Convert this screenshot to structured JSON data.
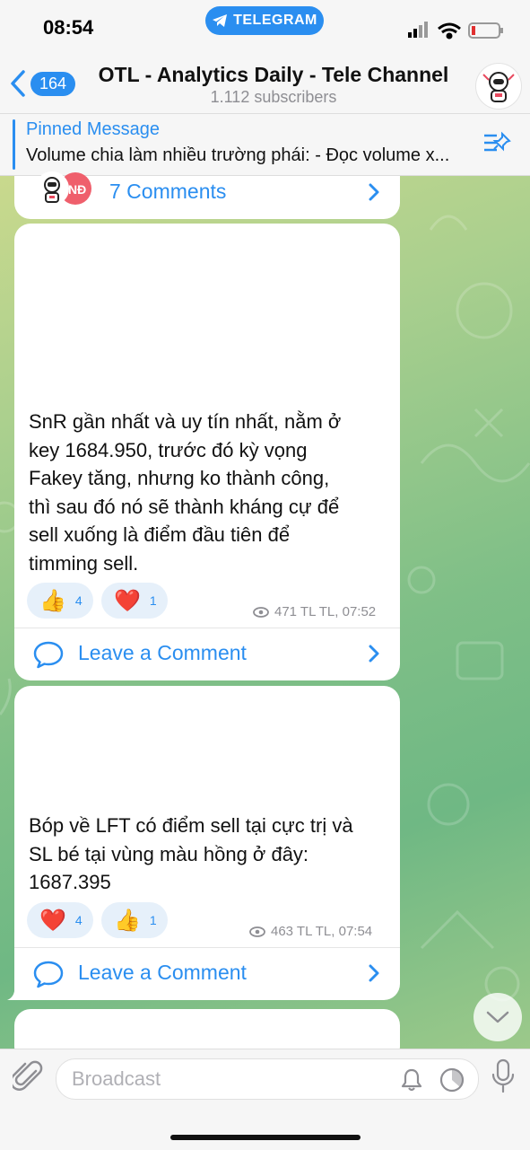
{
  "status": {
    "time": "08:54",
    "app_pill": "TELEGRAM"
  },
  "header": {
    "back_count": "164",
    "title": "OTL - Analytics Daily - Tele Channel",
    "subscribers": "1.112 subscribers"
  },
  "pinned": {
    "label": "Pinned Message",
    "text": "Volume chia làm nhiều trường phái: - Đọc volume x..."
  },
  "top_comments": {
    "label": "7 Comments",
    "avatar_text": "NĐ"
  },
  "messages": [
    {
      "lines": [
        "SnR gần nhất và uy tín nhất, nằm ở",
        "key 1684.950, trước đó kỳ vọng",
        "Fakey tăng, nhưng ko thành công,",
        "thì sau đó nó sẽ thành kháng cự để",
        "sell xuống là điểm đầu tiên để",
        "timming sell."
      ],
      "reactions": [
        {
          "emoji": "👍",
          "count": "4"
        },
        {
          "emoji": "❤️",
          "count": "1"
        }
      ],
      "views": "471 TL TL, 07:52",
      "comment_label": "Leave a Comment"
    },
    {
      "lines": [
        "Bóp về LFT có điểm sell tại cực trị và",
        "SL bé tại vùng màu hồng ở đây:",
        "1687.395"
      ],
      "reactions": [
        {
          "emoji": "❤️",
          "count": "4"
        },
        {
          "emoji": "👍",
          "count": "1"
        }
      ],
      "views": "463 TL TL, 07:54",
      "comment_label": "Leave a Comment"
    }
  ],
  "composer": {
    "placeholder": "Broadcast"
  },
  "colors": {
    "accent": "#2a8ef0",
    "reaction_bg": "#e6f0fa"
  }
}
